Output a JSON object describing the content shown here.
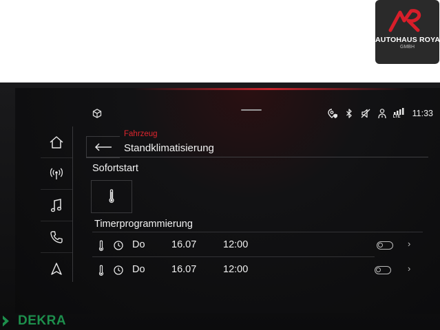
{
  "logo": {
    "brand": "AUTOHAUS ROYAL",
    "sub": "GMBH",
    "monogram": "AR"
  },
  "status": {
    "time": "11:33",
    "lte": "LTE",
    "icons": [
      "box-icon",
      "location-shield-icon",
      "bluetooth-icon",
      "mute-icon",
      "person-info-icon",
      "signal-lte-icon"
    ]
  },
  "nav": {
    "items": [
      "home-icon",
      "radio-icon",
      "music-icon",
      "phone-icon",
      "navigation-icon"
    ]
  },
  "header": {
    "breadcrumb": "Fahrzeug",
    "title": "Standklimatisierung"
  },
  "sections": {
    "instant_start": "Sofortstart",
    "timer": "Timerprogrammierung"
  },
  "timers": [
    {
      "day": "Do",
      "date": "16.07",
      "time": "12:00"
    },
    {
      "day": "Do",
      "date": "16.07",
      "time": "12:00"
    }
  ],
  "watermark": {
    "text": "DEKRA"
  },
  "colors": {
    "accent": "#e0262e",
    "text": "#f2f2f2",
    "dekra": "#1d8f4c"
  }
}
